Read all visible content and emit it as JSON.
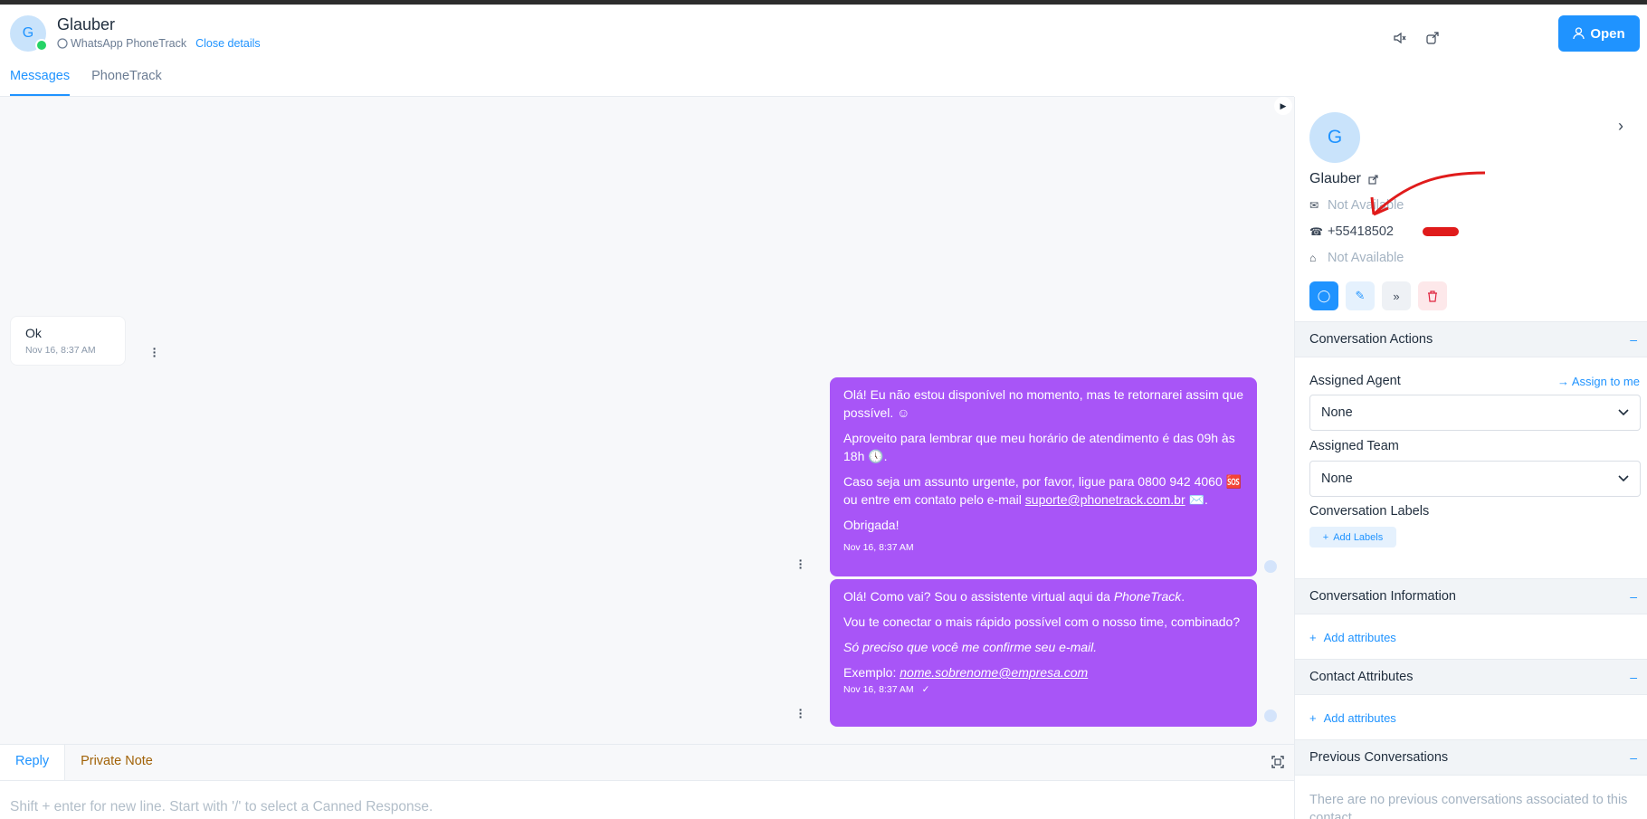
{
  "header": {
    "avatar_initial": "G",
    "contact_name": "Glauber",
    "inbox_name": "WhatsApp PhoneTrack",
    "close_details": "Close details",
    "open_button": "Open"
  },
  "tabs": [
    {
      "label": "Messages",
      "active": true
    },
    {
      "label": "PhoneTrack",
      "active": false
    }
  ],
  "messages": {
    "incoming": {
      "text": "Ok",
      "time": "Nov 16, 8:37 AM"
    },
    "outgoing1": {
      "p1": "Olá! Eu não estou disponível no momento, mas te retornarei assim que possível. ☺",
      "p2": "Aproveito para lembrar que meu horário de atendimento é das 09h às 18h 🕔.",
      "p3_pre": "Caso seja um assunto urgente, por favor, ligue para 0800 942 4060 🆘 ou entre em contato pelo e-mail ",
      "p3_link": "suporte@phonetrack.com.br",
      "p3_post": " ✉️.",
      "p4": "Obrigada!",
      "time": "Nov 16, 8:37 AM"
    },
    "outgoing2": {
      "p1_pre": "Olá! Como vai? Sou o assistente virtual aqui da ",
      "p1_em": "PhoneTrack",
      "p1_post": ".",
      "p2": "Vou te conectar o mais rápido possível com o nosso time, combinado?",
      "p3": "Só preciso que você me confirme seu e-mail.",
      "p4_pre": "Exemplo: ",
      "p4_link": "nome.sobrenome@empresa.com",
      "time": "Nov 16, 8:37 AM"
    }
  },
  "reply": {
    "tab_reply": "Reply",
    "tab_note": "Private Note",
    "placeholder": "Shift + enter for new line. Start with '/' to select a Canned Response."
  },
  "sidebar": {
    "avatar_initial": "G",
    "name": "Glauber",
    "email": "Not Available",
    "phone": "+55418502",
    "company": "Not Available",
    "conversation_actions": "Conversation Actions",
    "assigned_agent_label": "Assigned Agent",
    "assign_to_me": "Assign to me",
    "assigned_agent_value": "None",
    "assigned_team_label": "Assigned Team",
    "assigned_team_value": "None",
    "labels_label": "Conversation Labels",
    "add_labels": "Add Labels",
    "conversation_information": "Conversation Information",
    "add_attributes_1": "Add attributes",
    "contact_attributes": "Contact Attributes",
    "add_attributes_2": "Add attributes",
    "previous_conversations": "Previous Conversations",
    "no_previous": "There are no previous conversations associated to this contact.",
    "collapse_symbol": "–"
  },
  "colors": {
    "accent": "#1f93ff",
    "outgoing_bubble": "#a855f7",
    "annotation": "#e01b1b"
  }
}
